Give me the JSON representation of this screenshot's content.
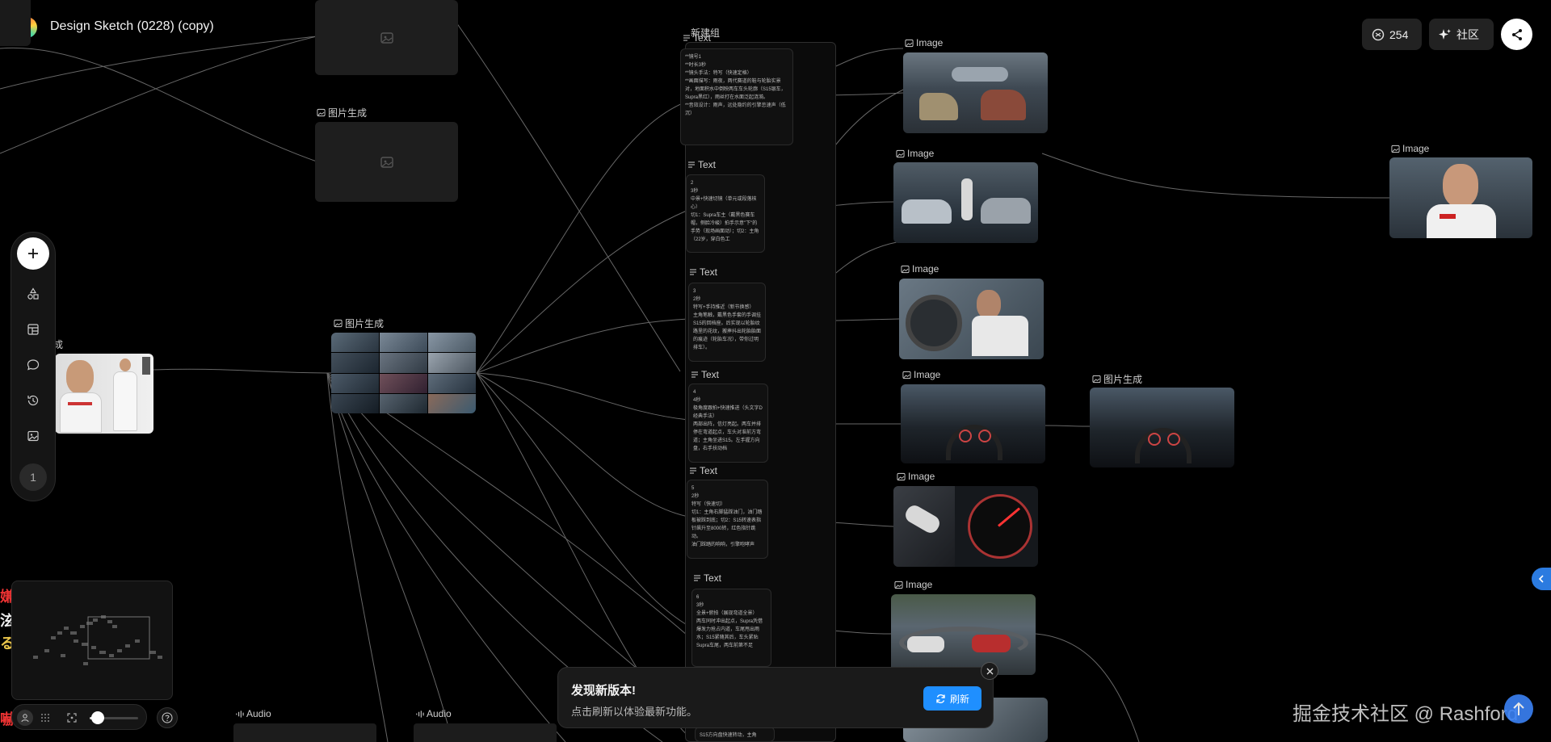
{
  "header": {
    "title": "Design Sketch (0228) (copy)",
    "credits": "254",
    "community_label": "社区"
  },
  "toolbar": {
    "page_number": "1"
  },
  "canvas": {
    "labels": {
      "image_gen": "图片生成",
      "image": "Image",
      "text": "Text",
      "group": "新建组",
      "audio": "Audio",
      "cut_label": "成"
    },
    "text_cards": [
      "**镜号1\n**时长3秒\n**镜头手法：特写（快速定格）\n**画面描写：雨夜，两代赛道的鞋与轮胎实景对，地面积水中倒映两车车头轮廓（S15银车，Supra黑红），雨丝打在水面泛起涟漪。\n**音效设计：雨声，远处隐约的引擎怠速声（低沉）",
      "2\n3秒\n中景+快速切镜（单元或段落核心）\n切1：Supra车主（戴黑色赛车帽，侧脸冷峻）拍手示意\"下\"的手势（现场画面动）；切2：主角（22岁，穿白色工",
      "3\n2秒\n特写+手持推近（新节换感）\n主角笔触，戴黑色手套的手调挂S15的回档座。后实现以轮胎纹路里的花纹，搬摔抖出轮胎胎面的痕迹（轮胎车况），带你过明排车）。",
      "4\n4秒\n极角度跟拍+快速推进（头文字D经典手法）\n两部出阵，信灯亮起。两车并排停在弯道起点，车头对准前方弯道；主角坐进S15。左手握方向盘，右手扶动档",
      "5\n2秒\n特写（快速切）\n切1：主角右脚猛踩油门，油门踏板被踩到底；切2：S15转速表指针飙升至8000转，红色指针跳动。\n油门踩踏的响响，引擎咆哮声",
      "6\n3秒\n全景+俯拍（展现弯道全景）\n两车同时冲出起点，Supra凭借爆发力抢占内道，车尾甩出雨水；S15紧随其后，车头紧贴Supra车尾，两车前第不足",
      "S15方向盘快速转动，主角"
    ]
  },
  "toast": {
    "title": "发现新版本!",
    "body": "点击刷新以体验最新功能。",
    "refresh_label": "刷新"
  },
  "minimap": {
    "side_glyphs": [
      "嫌",
      "泫",
      "る",
      "嚇"
    ]
  },
  "watermark": "掘金技术社区 @ Rashford",
  "colors": {
    "accent": "#1f8fff",
    "canvas_bg": "#000000",
    "node_bg": "#1e1e1e"
  },
  "icons": [
    "app-logo-icon",
    "credits-icon",
    "sparkle-icon",
    "share-icon",
    "plus-icon",
    "shapes-icon",
    "layout-icon",
    "chat-icon",
    "history-icon",
    "image-icon",
    "close-icon",
    "refresh-icon",
    "collapse-icon",
    "grid-icon",
    "fit-icon",
    "help-icon",
    "audio-icon"
  ]
}
